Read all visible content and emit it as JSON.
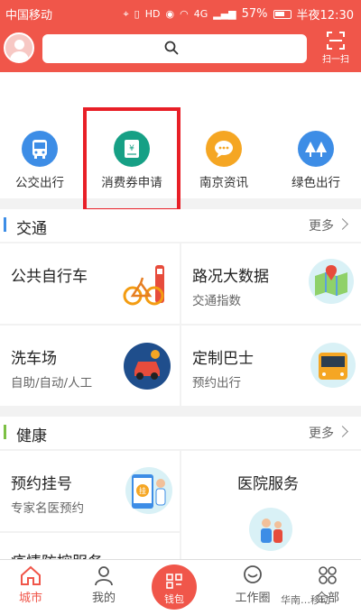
{
  "status": {
    "carrier": "中国移动",
    "signal": "4G",
    "battery": "57%",
    "time": "半夜12:30"
  },
  "header": {
    "scan_label": "扫一扫"
  },
  "quick": [
    {
      "label": "公交出行",
      "icon": "bus-icon",
      "color": "#3d8de6"
    },
    {
      "label": "消费券申请",
      "icon": "voucher-icon",
      "color": "#16a085"
    },
    {
      "label": "南京资讯",
      "icon": "chat-icon",
      "color": "#f5a623"
    },
    {
      "label": "绿色出行",
      "icon": "tree-icon",
      "color": "#3d8de6"
    }
  ],
  "traffic": {
    "title": "交通",
    "more": "更多",
    "accent": "#3d8de6",
    "cards": [
      {
        "title": "公共自行车",
        "sub": ""
      },
      {
        "title": "路况大数据",
        "sub": "交通指数"
      },
      {
        "title": "洗车场",
        "sub": "自助/自动/人工"
      },
      {
        "title": "定制巴士",
        "sub": "预约出行"
      }
    ]
  },
  "health": {
    "title": "健康",
    "more": "更多",
    "accent": "#7cc044",
    "cards": [
      {
        "title": "预约挂号",
        "sub": "专家名医预约",
        "badge": "挂"
      },
      {
        "title": "医院服务",
        "sub": ""
      },
      {
        "title": "疫情防控服务",
        "sub": ""
      }
    ]
  },
  "tabs": [
    {
      "label": "城市",
      "icon": "home-icon"
    },
    {
      "label": "我的",
      "icon": "person-icon"
    },
    {
      "label": "钱包",
      "icon": "wallet-icon"
    },
    {
      "label": "工作圈",
      "icon": "chat-bubble-icon"
    },
    {
      "label": "全部",
      "icon": "grid-icon"
    }
  ],
  "watermark": "华南…移动"
}
